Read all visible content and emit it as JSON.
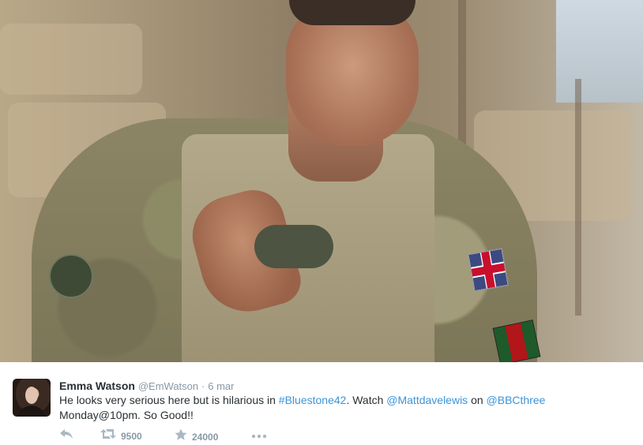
{
  "tweet": {
    "author_name": "Emma Watson",
    "author_handle": "@EmWatson",
    "separator": "·",
    "date": "6 mar",
    "text_parts": [
      {
        "text": "He looks very serious here but is hilarious in ",
        "type": "text"
      },
      {
        "text": "#Bluestone42",
        "type": "hashtag"
      },
      {
        "text": ". Watch ",
        "type": "text"
      },
      {
        "text": "@Mattdavelewis",
        "type": "mention"
      },
      {
        "text": " on ",
        "type": "text"
      },
      {
        "text": "@BBCthree",
        "type": "mention"
      },
      {
        "text": " Monday@10pm. So Good!!",
        "type": "text"
      }
    ],
    "retweet_count": "9500",
    "favorite_count": "24000",
    "link_color": "#3b94d9"
  },
  "icons": {
    "reply": "reply-icon",
    "retweet": "retweet-icon",
    "favorite": "star-icon",
    "more": "more-icon"
  }
}
